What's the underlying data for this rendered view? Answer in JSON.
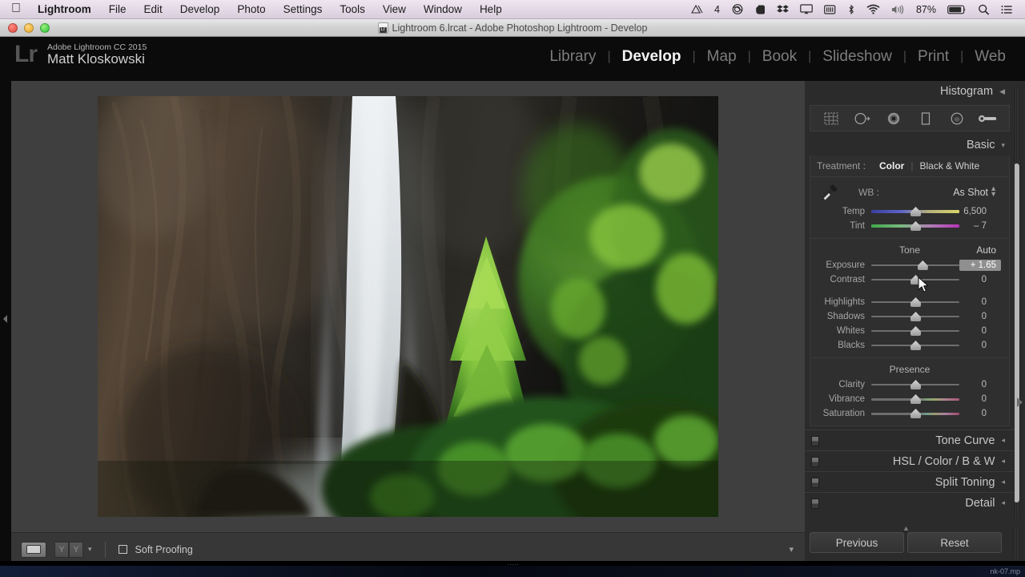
{
  "macbar": {
    "apple_icon": "apple-icon",
    "menus": [
      {
        "label": "Lightroom",
        "bold": true
      },
      {
        "label": "File",
        "bold": false
      },
      {
        "label": "Edit",
        "bold": false
      },
      {
        "label": "Develop",
        "bold": false
      },
      {
        "label": "Photo",
        "bold": false
      },
      {
        "label": "Settings",
        "bold": false
      },
      {
        "label": "Tools",
        "bold": false
      },
      {
        "label": "View",
        "bold": false
      },
      {
        "label": "Window",
        "bold": false
      },
      {
        "label": "Help",
        "bold": false
      }
    ],
    "status": {
      "display_count": "4",
      "battery_percent": "87%",
      "icons": [
        "display-mirror-icon",
        "creative-cloud-icon",
        "evernote-icon",
        "dropbox-icon",
        "airplay-icon",
        "battery-widget-icon",
        "bluetooth-icon",
        "wifi-icon",
        "volume-icon",
        "battery-icon",
        "spotlight-search-icon",
        "notification-center-icon"
      ]
    }
  },
  "titlebar": {
    "title": "Lightroom 6.lrcat - Adobe Photoshop Lightroom - Develop",
    "doc_icon": "lightroom-catalog-icon",
    "close_label": "close",
    "minimize_label": "minimize",
    "zoom_label": "zoom"
  },
  "identity": {
    "logo": "Lr",
    "line1": "Adobe Lightroom CC 2015",
    "line2": "Matt Kloskowski"
  },
  "modules": [
    {
      "label": "Library",
      "active": false
    },
    {
      "label": "Develop",
      "active": true
    },
    {
      "label": "Map",
      "active": false
    },
    {
      "label": "Book",
      "active": false
    },
    {
      "label": "Slideshow",
      "active": false
    },
    {
      "label": "Print",
      "active": false
    },
    {
      "label": "Web",
      "active": false
    }
  ],
  "right_panel": {
    "histogram": {
      "title": "Histogram",
      "collapse_icon": "triangle-left-icon"
    },
    "tools": [
      {
        "name": "crop-overlay-tool",
        "selected": false
      },
      {
        "name": "spot-removal-tool",
        "selected": false
      },
      {
        "name": "red-eye-correction-tool",
        "selected": false
      },
      {
        "name": "graduated-filter-tool",
        "selected": false
      },
      {
        "name": "radial-filter-tool",
        "selected": false
      },
      {
        "name": "adjustment-brush-tool",
        "selected": false
      }
    ],
    "basic": {
      "title": "Basic",
      "treatment_label": "Treatment :",
      "treatment_options": [
        {
          "label": "Color",
          "selected": true
        },
        {
          "label": "Black & White",
          "selected": false
        }
      ],
      "wb_label": "WB :",
      "wb_value": "As Shot",
      "eyedropper_icon": "white-balance-eyedropper-icon",
      "wb_sliders": [
        {
          "name": "Temp",
          "value": "6,500",
          "pos": 50,
          "bar": "temp"
        },
        {
          "name": "Tint",
          "value": "– 7",
          "pos": 50,
          "bar": "tint"
        }
      ],
      "tone_header": "Tone",
      "auto_label": "Auto",
      "tone_sliders": [
        {
          "name": "Exposure",
          "value": "+ 1.65",
          "pos": 58,
          "bar": "plain",
          "highlight": true
        },
        {
          "name": "Contrast",
          "value": "0",
          "pos": 50,
          "bar": "plain",
          "highlight": false
        }
      ],
      "tone_sliders2": [
        {
          "name": "Highlights",
          "value": "0",
          "pos": 50,
          "bar": "plain",
          "highlight": false
        },
        {
          "name": "Shadows",
          "value": "0",
          "pos": 50,
          "bar": "plain",
          "highlight": false
        },
        {
          "name": "Whites",
          "value": "0",
          "pos": 50,
          "bar": "plain",
          "highlight": false
        },
        {
          "name": "Blacks",
          "value": "0",
          "pos": 50,
          "bar": "plain",
          "highlight": false
        }
      ],
      "presence_header": "Presence",
      "presence_sliders": [
        {
          "name": "Clarity",
          "value": "0",
          "pos": 50,
          "bar": "plain",
          "highlight": false
        },
        {
          "name": "Vibrance",
          "value": "0",
          "pos": 50,
          "bar": "vib",
          "highlight": false
        },
        {
          "name": "Saturation",
          "value": "0",
          "pos": 50,
          "bar": "sat",
          "highlight": false
        }
      ]
    },
    "panels": [
      {
        "title": "Tone Curve",
        "switch": true
      },
      {
        "title": "HSL / Color / B & W",
        "switch": true
      },
      {
        "title": "Split Toning",
        "switch": true
      },
      {
        "title": "Detail",
        "switch": true
      }
    ],
    "buttons": {
      "previous": "Previous",
      "reset": "Reset"
    }
  },
  "photo_toolbar": {
    "view_button": "loupe-view-button",
    "before_after_button": "before-after-button",
    "caret_icon": "chevron-down-icon",
    "soft_proofing_label": "Soft Proofing",
    "soft_proofing_checked": false,
    "expand_icon": "chevron-down-icon"
  },
  "photo": {
    "alt": "Yosemite waterfall with granite cliff and sunlit conifer"
  },
  "os_strip": {
    "fragment": "nk-07.mp"
  }
}
